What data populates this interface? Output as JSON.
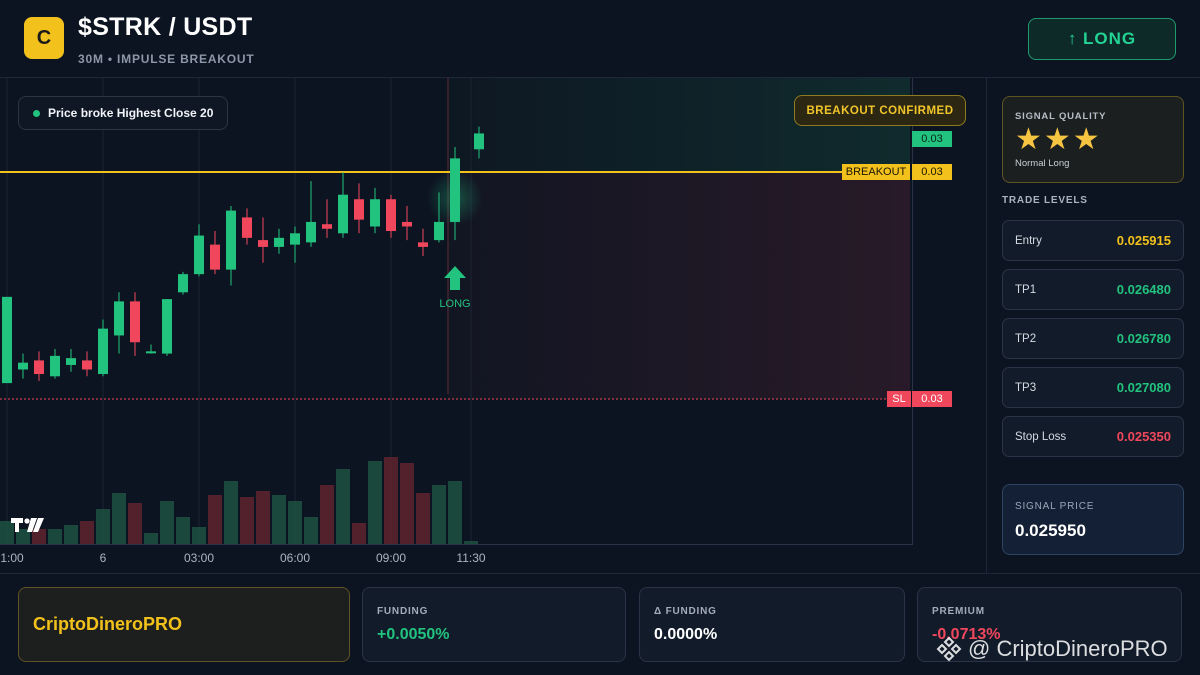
{
  "header": {
    "logo_letter": "C",
    "pair": "$STRK / USDT",
    "subtitle": "30M • IMPULSE BREAKOUT",
    "action_label": "↑ LONG"
  },
  "chart": {
    "info_pill": "Price broke Highest Close 20",
    "breakout_badge": "BREAKOUT CONFIRMED",
    "breakout_tag": "BREAKOUT",
    "sl_tag": "SL",
    "price_tag_current": "0.03",
    "price_tag_breakout": "0.03",
    "price_tag_sl": "0.03",
    "signal_marker": "LONG",
    "x_ticks": [
      "1:00",
      "6",
      "03:00",
      "06:00",
      "09:00",
      "11:30"
    ],
    "colors": {
      "up": "#22c37f",
      "down": "#f0475c",
      "breakout": "#f3c11b",
      "sl": "#f0475c"
    }
  },
  "chart_data": {
    "type": "candlestick",
    "x": [
      "1:00",
      "6",
      "03:00",
      "06:00",
      "09:00",
      "11:30"
    ],
    "price_scale_label": "0.03",
    "breakout_level": "0.03",
    "stop_level": "0.03",
    "candles": [
      {
        "o": 0.02527,
        "h": 0.02542,
        "l": 0.02528,
        "c": 0.02565
      },
      {
        "o": 0.02533,
        "h": 0.0254,
        "l": 0.02529,
        "c": 0.02536
      },
      {
        "o": 0.02537,
        "h": 0.02541,
        "l": 0.02528,
        "c": 0.02531
      },
      {
        "o": 0.0253,
        "h": 0.02542,
        "l": 0.02529,
        "c": 0.02539
      },
      {
        "o": 0.02535,
        "h": 0.02542,
        "l": 0.02532,
        "c": 0.02538
      },
      {
        "o": 0.02537,
        "h": 0.02541,
        "l": 0.0253,
        "c": 0.02533
      },
      {
        "o": 0.02531,
        "h": 0.02555,
        "l": 0.0253,
        "c": 0.02551
      },
      {
        "o": 0.02548,
        "h": 0.02567,
        "l": 0.0254,
        "c": 0.02563
      },
      {
        "o": 0.02563,
        "h": 0.02567,
        "l": 0.02539,
        "c": 0.02545
      },
      {
        "o": 0.02541,
        "h": 0.02544,
        "l": 0.0254,
        "c": 0.02541
      },
      {
        "o": 0.0254,
        "h": 0.02564,
        "l": 0.02539,
        "c": 0.02564
      },
      {
        "o": 0.02567,
        "h": 0.02576,
        "l": 0.02566,
        "c": 0.02575
      },
      {
        "o": 0.02575,
        "h": 0.02597,
        "l": 0.02574,
        "c": 0.02592
      },
      {
        "o": 0.02588,
        "h": 0.02594,
        "l": 0.02575,
        "c": 0.02577
      },
      {
        "o": 0.02577,
        "h": 0.02605,
        "l": 0.0257,
        "c": 0.02603
      },
      {
        "o": 0.026,
        "h": 0.02604,
        "l": 0.02588,
        "c": 0.02591
      },
      {
        "o": 0.0259,
        "h": 0.026,
        "l": 0.0258,
        "c": 0.02587
      },
      {
        "o": 0.02587,
        "h": 0.02595,
        "l": 0.02584,
        "c": 0.02591
      },
      {
        "o": 0.02588,
        "h": 0.02596,
        "l": 0.0258,
        "c": 0.02593
      },
      {
        "o": 0.02589,
        "h": 0.02616,
        "l": 0.02587,
        "c": 0.02598
      },
      {
        "o": 0.02597,
        "h": 0.02608,
        "l": 0.02591,
        "c": 0.02595
      },
      {
        "o": 0.02593,
        "h": 0.0262,
        "l": 0.02591,
        "c": 0.0261
      },
      {
        "o": 0.02608,
        "h": 0.02615,
        "l": 0.02593,
        "c": 0.02599
      },
      {
        "o": 0.02596,
        "h": 0.02613,
        "l": 0.02593,
        "c": 0.02608
      },
      {
        "o": 0.02608,
        "h": 0.0261,
        "l": 0.02591,
        "c": 0.02594
      },
      {
        "o": 0.02598,
        "h": 0.02605,
        "l": 0.0259,
        "c": 0.02596
      },
      {
        "o": 0.02589,
        "h": 0.02595,
        "l": 0.02583,
        "c": 0.02587
      },
      {
        "o": 0.0259,
        "h": 0.02611,
        "l": 0.02589,
        "c": 0.02598
      },
      {
        "o": 0.02598,
        "h": 0.02631,
        "l": 0.0259,
        "c": 0.02626
      },
      {
        "o": 0.0263,
        "h": 0.0264,
        "l": 0.02626,
        "c": 0.02637
      }
    ],
    "volume": [
      0.12,
      0.08,
      0.08,
      0.08,
      0.1,
      0.12,
      0.18,
      0.26,
      0.21,
      0.06,
      0.22,
      0.14,
      0.09,
      0.25,
      0.32,
      0.24,
      0.27,
      0.25,
      0.22,
      0.14,
      0.3,
      0.38,
      0.11,
      0.42,
      0.44,
      0.41,
      0.26,
      0.3,
      0.32,
      0.02
    ]
  },
  "panel": {
    "quality_label": "SIGNAL QUALITY",
    "stars": "★★★",
    "quality_sub": "Normal Long",
    "trade_levels_title": "TRADE LEVELS",
    "levels": [
      {
        "name": "Entry",
        "value": "0.025915",
        "color": "#f3c11b"
      },
      {
        "name": "TP1",
        "value": "0.026480",
        "color": "#22c37f"
      },
      {
        "name": "TP2",
        "value": "0.026780",
        "color": "#22c37f"
      },
      {
        "name": "TP3",
        "value": "0.027080",
        "color": "#22c37f"
      },
      {
        "name": "Stop Loss",
        "value": "0.025350",
        "color": "#f0475c"
      }
    ],
    "signal_price_label": "SIGNAL PRICE",
    "signal_price": "0.025950"
  },
  "footer": {
    "brand": "CriptoDineroPRO",
    "funding_label": "FUNDING",
    "funding_value": "+0.0050%",
    "delta_funding_label": "Δ FUNDING",
    "delta_funding_value": "0.0000%",
    "premium_label": "PREMIUM",
    "premium_value": "-0.0713%",
    "watermark": "@ CriptoDineroPRO"
  }
}
